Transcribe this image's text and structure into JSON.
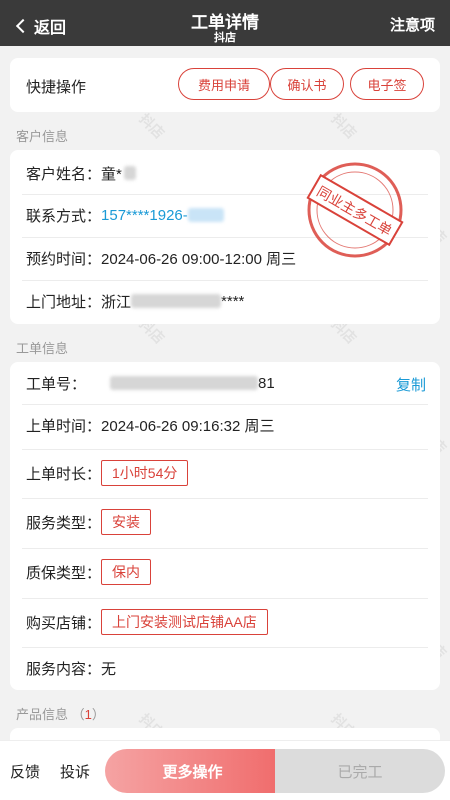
{
  "header": {
    "back_label": "返回",
    "title": "工单详情",
    "subtitle": "抖店",
    "notice_label": "注意项"
  },
  "quick_actions": {
    "label": "快捷操作",
    "buttons": [
      "费用申请",
      "确认书",
      "电子签"
    ]
  },
  "watermark_text": "抖店",
  "customer": {
    "section_title": "客户信息",
    "name_label": "客户姓名：",
    "name_value": "童*",
    "phone_label": "联系方式：",
    "phone_value": "157****1926-",
    "appointment_label": "预约时间：",
    "appointment_value": "2024-06-26 09:00-12:00 周三",
    "address_label": "上门地址：",
    "address_value_start": "浙江",
    "address_value_end": "****",
    "stamp_text": "同业主多工单"
  },
  "order": {
    "section_title": "工单信息",
    "order_no_label": "工单号：",
    "order_no_suffix": "81",
    "copy_label": "复制",
    "created_label": "上单时间：",
    "created_value": "2024-06-26 09:16:32 周三",
    "duration_label": "上单时长：",
    "duration_value": "1小时54分",
    "service_type_label": "服务类型：",
    "service_type_value": "安装",
    "warranty_label": "质保类型：",
    "warranty_value": "保内",
    "store_label": "购买店铺：",
    "store_value": "上门安装测试店铺AA店",
    "content_label": "服务内容：",
    "content_value": "无"
  },
  "product": {
    "section_title": "产品信息",
    "count": "1"
  },
  "bottom_bar": {
    "feedback_label": "反馈",
    "complaint_label": "投诉",
    "more_label": "更多操作",
    "done_label": "已完工"
  },
  "colors": {
    "accent_red": "#d9423a",
    "link_blue": "#1a9ad6",
    "header_bg": "#3a3a3a"
  }
}
